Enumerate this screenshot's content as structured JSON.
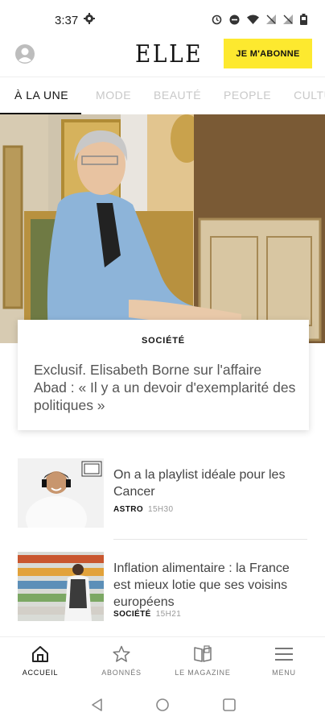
{
  "status": {
    "time": "3:37"
  },
  "header": {
    "logo": "ELLE",
    "subscribe_label": "JE M'ABONNE",
    "accent": "#fde92f"
  },
  "tabs": [
    {
      "label": "À LA UNE"
    },
    {
      "label": "MODE"
    },
    {
      "label": "BEAUTÉ"
    },
    {
      "label": "PEOPLE"
    },
    {
      "label": "CULTU"
    }
  ],
  "featured": {
    "category": "SOCIÉTÉ",
    "title": "Exclusif. Elisabeth Borne sur l'affaire Abad : « Il y a un devoir d'exemplarité des politiques »"
  },
  "articles": [
    {
      "title": "On a la playlist idéale pour les Cancer",
      "category": "ASTRO",
      "time": "15H30",
      "thumb": "woman-headphones"
    },
    {
      "title": "Inflation alimentaire : la France est mieux lotie que ses voisins européens",
      "category": "SOCIÉTÉ",
      "time": "15H21",
      "thumb": "supermarket-shopper"
    }
  ],
  "bottom_nav": [
    {
      "label": "ACCUEIL",
      "icon": "home-icon"
    },
    {
      "label": "ABONNÉS",
      "icon": "star-icon"
    },
    {
      "label": "LE MAGAZINE",
      "icon": "magazine-icon"
    },
    {
      "label": "MENU",
      "icon": "hamburger-icon"
    }
  ]
}
